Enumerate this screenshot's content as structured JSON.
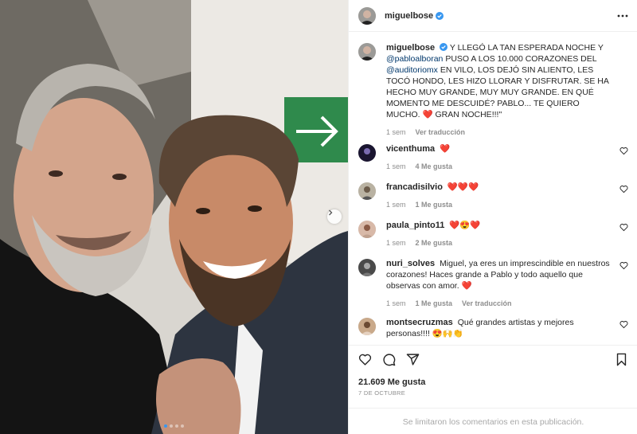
{
  "post": {
    "author": "miguelbose",
    "caption_text": "Y LLEGÓ LA TAN ESPERADA NOCHE Y",
    "caption_mention1": "@pabloalboran",
    "caption_text2": "PUSO A LOS 10.000 CORAZONES DEL",
    "caption_mention2": "@auditoriomx",
    "caption_text3": "EN VILO, LOS DEJÓ SIN ALIENTO, LES TOCÓ HONDO, LES HIZO LLORAR Y DISFRUTAR. SE HA HECHO MUY GRANDE, MUY MUY GRANDE. EN QUÉ MOMENTO ME DESCUIDÉ? PABLO... TE QUIERO MUCHO.",
    "caption_heart": "❤️",
    "caption_end": "GRAN NOCHE!!!\"",
    "caption_time": "1 sem",
    "caption_translate": "Ver traducción",
    "likes": "21.609 Me gusta",
    "date": "7 DE OCTUBRE",
    "comments_limited": "Se limitaron los comentarios en esta publicación.",
    "carousel": {
      "count": 4,
      "active": 1
    }
  },
  "comments": [
    {
      "user": "vicenthuma",
      "text": "❤️",
      "time": "1 sem",
      "likes": "4 Me gusta",
      "translate": ""
    },
    {
      "user": "francadisilvio",
      "text": "❤️❤️❤️",
      "time": "1 sem",
      "likes": "1 Me gusta",
      "translate": ""
    },
    {
      "user": "paula_pinto11",
      "text": "❤️😍❤️",
      "time": "1 sem",
      "likes": "2 Me gusta",
      "translate": ""
    },
    {
      "user": "nuri_solves",
      "text": "Miguel, ya eres un imprescindible en nuestros corazones! Haces grande a Pablo y todo aquello que observas con amor. ❤️",
      "time": "1 sem",
      "likes": "1 Me gusta",
      "translate": "Ver traducción"
    },
    {
      "user": "montsecruzmas",
      "text": "Qué grandes artistas y mejores personas!!!! 😍🙌👏",
      "time": "",
      "likes": "",
      "translate": ""
    }
  ],
  "icons": {
    "verified": "verified-badge-icon",
    "more": "more-options-icon",
    "like": "heart-icon",
    "comment": "comment-icon",
    "share": "share-icon",
    "save": "bookmark-icon",
    "next": "chevron-right-icon"
  },
  "colors": {
    "link": "#00376b",
    "verified": "#3897f0",
    "heart": "#ed4956",
    "muted": "#8e8e8e"
  }
}
